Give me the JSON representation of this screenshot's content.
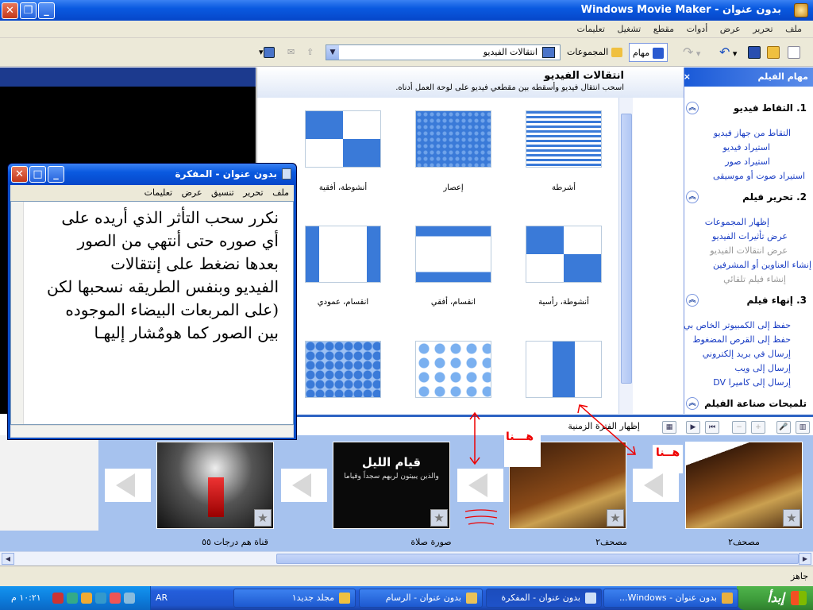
{
  "window": {
    "title": "بدون عنوان - Windows Movie Maker"
  },
  "menu": [
    "ملف",
    "تحرير",
    "عرض",
    "أدوات",
    "مقطع",
    "تشغيل",
    "تعليمات"
  ],
  "toolbar": {
    "tasks_label": "مهام",
    "collections_label": "المجموعات",
    "collection_value": "انتقالات الفيديو"
  },
  "collection": {
    "title": "انتقالات الفيديو",
    "subtitle": "اسحب انتقال فيديو وأسقطه بين مقطعي فيديو على لوحة العمل أدناه.",
    "items": [
      {
        "label": "أشرطة"
      },
      {
        "label": "إعصار"
      },
      {
        "label": "أنشوطة، أفقية"
      },
      {
        "label": "أنشوطة، رأسية"
      },
      {
        "label": "انقسام، أفقي"
      },
      {
        "label": "انقسام، عمودي"
      },
      {
        "label": ""
      },
      {
        "label": ""
      },
      {
        "label": ""
      }
    ]
  },
  "tasks": {
    "header": "مهام الفيلم",
    "close": "×",
    "sections": [
      {
        "title": "1. التقاط فيديو",
        "links": [
          "التقاط من جهاز فيديو",
          "استيراد فيديو",
          "استيراد صور",
          "استيراد صوت أو موسيقى"
        ]
      },
      {
        "title": "2. تحرير فيلم",
        "links": [
          "إظهار المجموعات",
          "عرض تأثيرات الفيديو",
          "عرض انتقالات الفيديو",
          "إنشاء العناوين أو المشرفين",
          "إنشاء فيلم تلقائي"
        ]
      },
      {
        "title": "3. إنهاء فيلم",
        "links": [
          "حفظ إلى الكمبيوتر الخاص بي",
          "حفظ إلى القرص المضغوط",
          "إرسال في بريد إلكتروني",
          "إرسال إلى ويب",
          "إرسال إلى كاميرا DV"
        ]
      },
      {
        "title": "تلميحات صناعة الفيلم",
        "links": []
      }
    ]
  },
  "timeline": {
    "label": "إظهار الفترة الزمنية"
  },
  "storyboard": {
    "clips": [
      {
        "label": "مصحف٢"
      },
      {
        "label": "مصحف٢"
      },
      {
        "label": "صورة صلاة",
        "caption": "قيام الليل",
        "sub": "والذين يبيتون لربهم سجداً وقياما"
      },
      {
        "label": "قناة هم درجات ٥٥"
      }
    ],
    "annotations": [
      "هـــنا",
      "هــنا"
    ]
  },
  "status": {
    "text": "جاهز"
  },
  "notepad": {
    "title": "بدون عنوان - المفكرة",
    "menu": [
      "ملف",
      "تحرير",
      "تنسيق",
      "عرض",
      "تعليمات"
    ],
    "lines": [
      "نكرر سحب التأثر الذي أريده على",
      "أي صوره حتى أنتهي من الصور",
      "بعدها نضغط على إنتقالات",
      "الفيديو وبنفس الطريقه نسحبها لكن",
      "(على المربعات البيضاء الموجوده",
      "بين الصور كما هومٌشار إليهـا"
    ]
  },
  "taskbar": {
    "start": "إبدأ",
    "lang": "AR",
    "clock": "١٠:٢١ م",
    "tasks": [
      "بدون عنوان - Windows...",
      "بدون عنوان - المفكرة",
      "بدون عنوان - الرسام",
      "مجلد جديد١"
    ]
  },
  "colors": {
    "xp_blue": "#0a5ae0",
    "accent_red": "#e00000",
    "storyboard": "#a6c2ee"
  }
}
